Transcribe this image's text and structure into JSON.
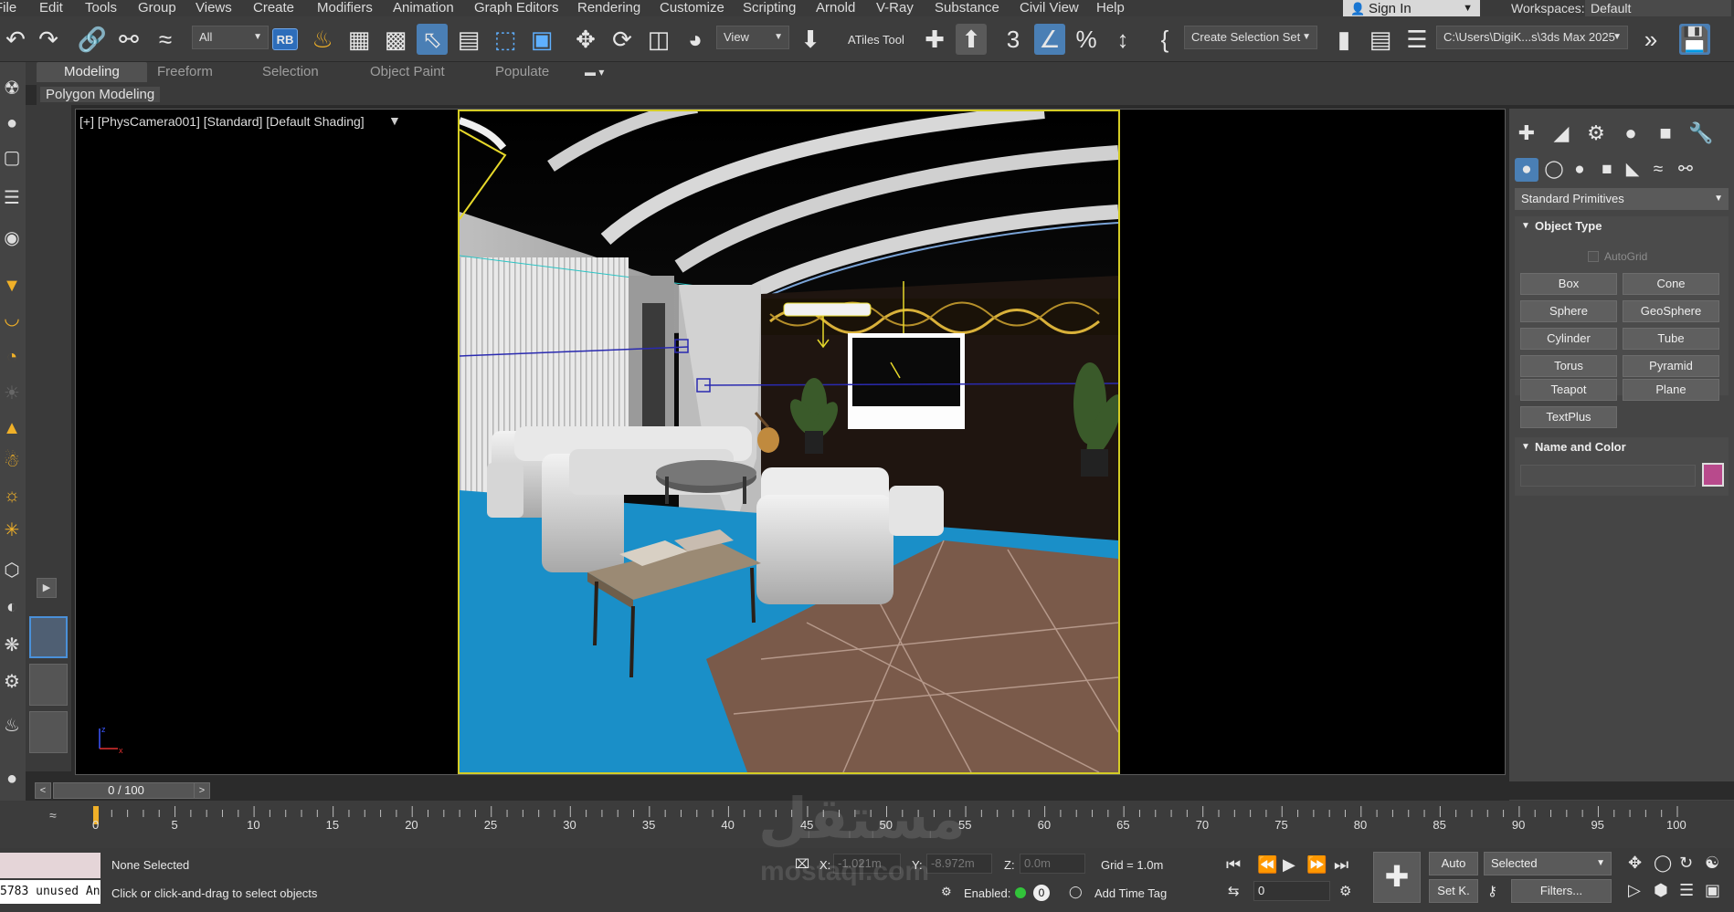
{
  "menu": [
    "File",
    "Edit",
    "Tools",
    "Group",
    "Views",
    "Create",
    "Modifiers",
    "Animation",
    "Graph Editors",
    "Rendering",
    "Customize",
    "Scripting",
    "Arnold",
    "V-Ray",
    "Substance",
    "Civil View",
    "Help"
  ],
  "account": {
    "sign_in": "Sign In",
    "workspaces_label": "Workspaces:",
    "workspace": "Default"
  },
  "toolbar": {
    "selection_filter": "All",
    "rb_label": "RB",
    "ref_coord": "View",
    "atiles": "ATiles Tool",
    "selection_set": "Create Selection Set",
    "project_path": "C:\\Users\\DigiK...s\\3ds Max 2025"
  },
  "ribbon": {
    "tabs": [
      "Modeling",
      "Freeform",
      "Selection",
      "Object Paint",
      "Populate"
    ],
    "active_tab": "Modeling",
    "sub_label": "Polygon Modeling"
  },
  "viewport": {
    "label": "[+] [PhysCamera001] [Standard] [Default Shading]"
  },
  "command_panel": {
    "category": "Standard Primitives",
    "object_type_title": "Object Type",
    "autogrid": "AutoGrid",
    "primitives": [
      "Box",
      "Cone",
      "Sphere",
      "GeoSphere",
      "Cylinder",
      "Tube",
      "Torus",
      "Pyramid",
      "Teapot",
      "Plane",
      "TextPlus"
    ],
    "name_color_title": "Name and Color",
    "object_color": "#b84a8c"
  },
  "timeline": {
    "frame_display": "0 / 100",
    "ticks": [
      "0",
      "5",
      "10",
      "15",
      "20",
      "25",
      "30",
      "35",
      "40",
      "45",
      "50",
      "55",
      "60",
      "65",
      "70",
      "75",
      "80",
      "85",
      "90",
      "95",
      "100"
    ],
    "prev_label": "<",
    "next_label": ">"
  },
  "status": {
    "maxscript_output": "5783 unused An",
    "selection": "None Selected",
    "prompt": "Click or click-and-drag to select objects",
    "x_label": "X:",
    "x_value": "-1.021m",
    "y_label": "Y:",
    "y_value": "-8.972m",
    "z_label": "Z:",
    "z_value": "0.0m",
    "grid": "Grid = 1.0m",
    "enabled_label": "Enabled:",
    "time_tag": "Add Time Tag",
    "current_frame": "0",
    "auto_key": "Auto",
    "key_mode": "Selected",
    "set_key": "Set K.",
    "filters": "Filters..."
  },
  "watermark": {
    "arabic": "مستقل",
    "latin": "mostaql.com"
  }
}
